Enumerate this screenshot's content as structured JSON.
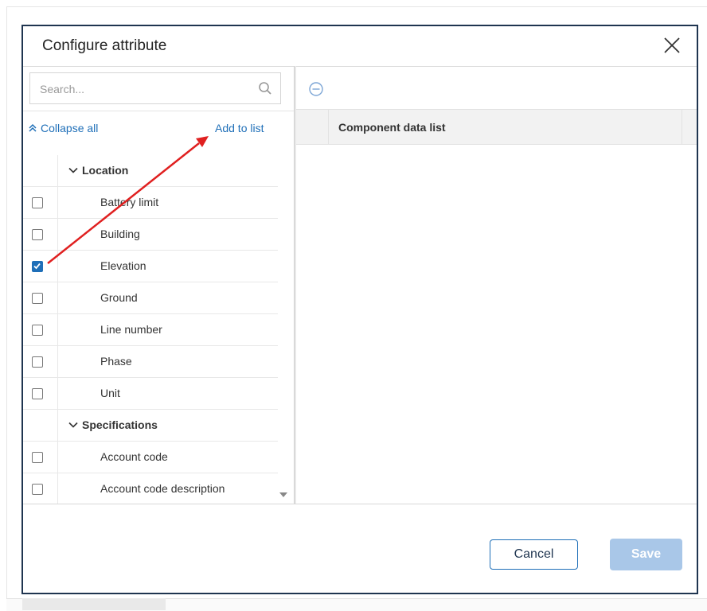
{
  "dialog": {
    "title": "Configure attribute"
  },
  "left_pane": {
    "search": {
      "placeholder": "Search..."
    },
    "collapse_all_label": "Collapse all",
    "add_to_list_label": "Add to list",
    "groups": [
      {
        "label": "Location",
        "items": [
          {
            "label": "Battery limit",
            "checked": false
          },
          {
            "label": "Building",
            "checked": false
          },
          {
            "label": "Elevation",
            "checked": true
          },
          {
            "label": "Ground",
            "checked": false
          },
          {
            "label": "Line number",
            "checked": false
          },
          {
            "label": "Phase",
            "checked": false
          },
          {
            "label": "Unit",
            "checked": false
          }
        ]
      },
      {
        "label": "Specifications",
        "items": [
          {
            "label": "Account code",
            "checked": false
          },
          {
            "label": "Account code description",
            "checked": false
          }
        ]
      }
    ]
  },
  "right_pane": {
    "column_header": "Component data list"
  },
  "footer": {
    "cancel_label": "Cancel",
    "save_label": "Save"
  },
  "colors": {
    "accent": "#1f6fb8",
    "dialog_border": "#1f3550",
    "save_disabled": "#a9c7e8",
    "annotation_arrow": "#e02020"
  },
  "icons": [
    "close-icon",
    "search-icon",
    "collapse-all-icon",
    "chevron-down-icon",
    "remove-icon",
    "checkbox-check-icon",
    "scroll-down-icon"
  ]
}
